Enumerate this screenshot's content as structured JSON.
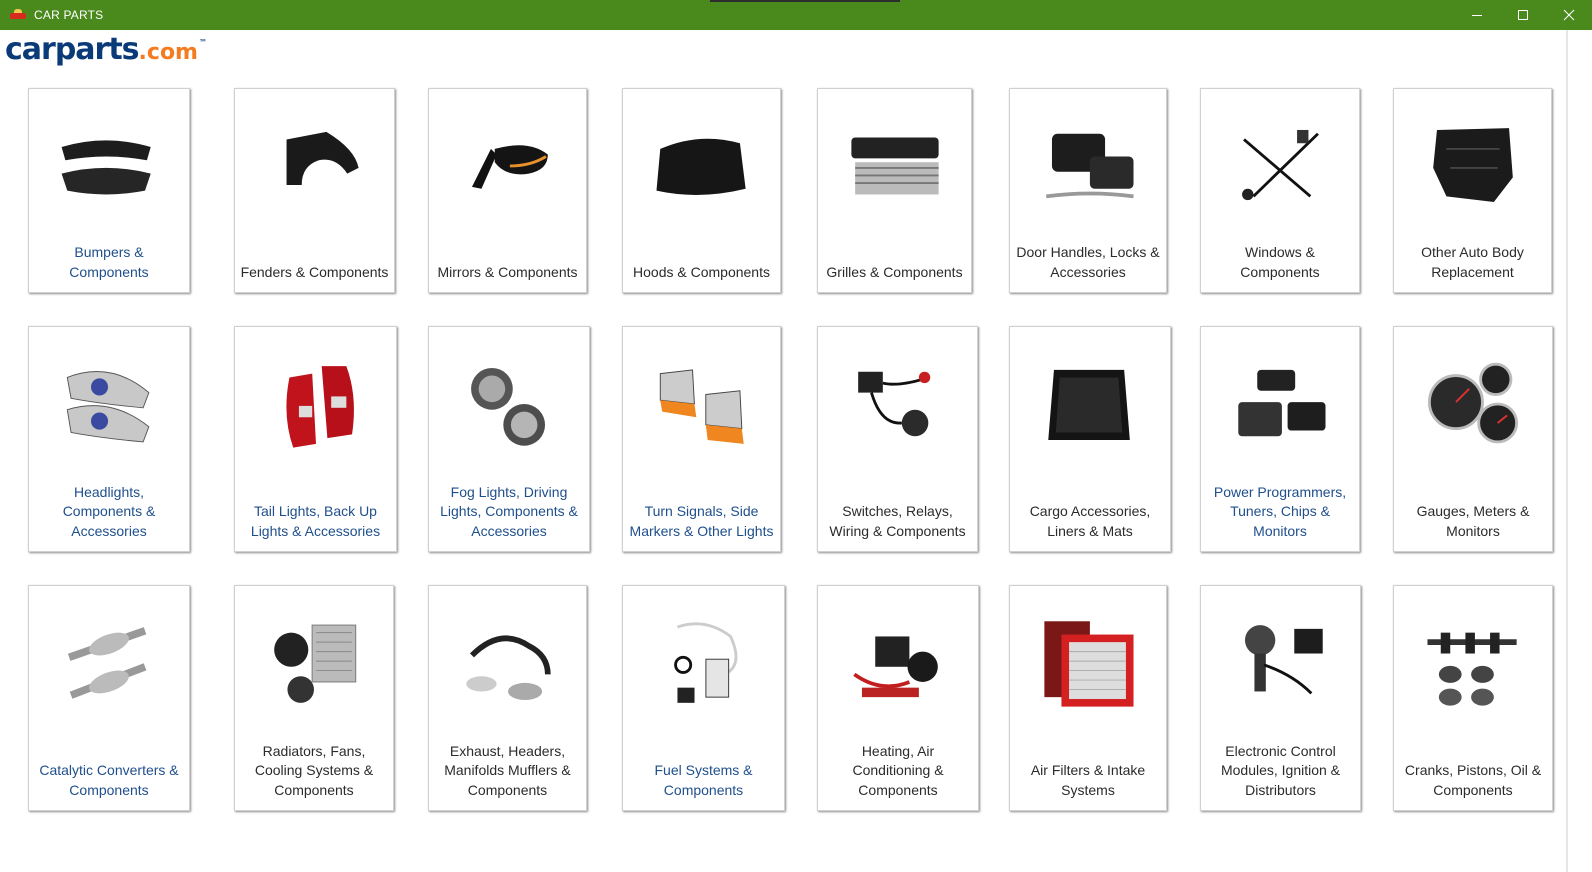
{
  "window": {
    "title": "CAR PARTS",
    "title_bar_color": "#4a8a1c"
  },
  "logo": {
    "text_main": "carparts",
    "text_suffix": ".com",
    "trademark": "™",
    "color_main": "#0b3a78",
    "color_suffix": "#f47b20"
  },
  "categories": [
    {
      "label": "Bumpers & Components",
      "icon": "bumper-icon",
      "link_color": true
    },
    {
      "label": "Fenders & Components",
      "icon": "fender-icon",
      "link_color": false
    },
    {
      "label": "Mirrors & Components",
      "icon": "mirror-icon",
      "link_color": false
    },
    {
      "label": "Hoods & Components",
      "icon": "hood-icon",
      "link_color": false
    },
    {
      "label": "Grilles & Components",
      "icon": "grille-icon",
      "link_color": false
    },
    {
      "label": "Door Handles, Locks & Accessories",
      "icon": "door-handle-icon",
      "link_color": false
    },
    {
      "label": "Windows & Components",
      "icon": "window-regulator-icon",
      "link_color": false
    },
    {
      "label": "Other Auto Body Replacement",
      "icon": "body-panel-icon",
      "link_color": false
    },
    {
      "label": "Headlights, Components & Accessories",
      "icon": "headlight-icon",
      "link_color": true
    },
    {
      "label": "Tail Lights, Back Up Lights & Accessories",
      "icon": "tail-light-icon",
      "link_color": true
    },
    {
      "label": "Fog Lights, Driving Lights, Components & Accessories",
      "icon": "fog-light-icon",
      "link_color": true
    },
    {
      "label": "Turn Signals, Side Markers & Other Lights",
      "icon": "turn-signal-icon",
      "link_color": true
    },
    {
      "label": "Switches, Relays, Wiring & Components",
      "icon": "switch-wiring-icon",
      "link_color": false
    },
    {
      "label": "Cargo Accessories, Liners & Mats",
      "icon": "cargo-liner-icon",
      "link_color": false
    },
    {
      "label": "Power Programmers, Tuners, Chips & Monitors",
      "icon": "programmer-icon",
      "link_color": true
    },
    {
      "label": "Gauges, Meters & Monitors",
      "icon": "gauge-icon",
      "link_color": false
    },
    {
      "label": "Catalytic Converters & Components",
      "icon": "catalytic-converter-icon",
      "link_color": true
    },
    {
      "label": "Radiators, Fans, Cooling Systems & Components",
      "icon": "radiator-icon",
      "link_color": false
    },
    {
      "label": "Exhaust, Headers, Manifolds Mufflers & Components",
      "icon": "exhaust-icon",
      "link_color": false
    },
    {
      "label": "Fuel Systems & Components",
      "icon": "fuel-pump-icon",
      "link_color": true
    },
    {
      "label": "Heating, Air Conditioning & Components",
      "icon": "hvac-icon",
      "link_color": false
    },
    {
      "label": "Air Filters & Intake Systems",
      "icon": "air-filter-icon",
      "link_color": false
    },
    {
      "label": "Electronic Control Modules, Ignition & Distributors",
      "icon": "distributor-icon",
      "link_color": false
    },
    {
      "label": "Cranks, Pistons, Oil & Components",
      "icon": "crankshaft-icon",
      "link_color": false
    }
  ]
}
